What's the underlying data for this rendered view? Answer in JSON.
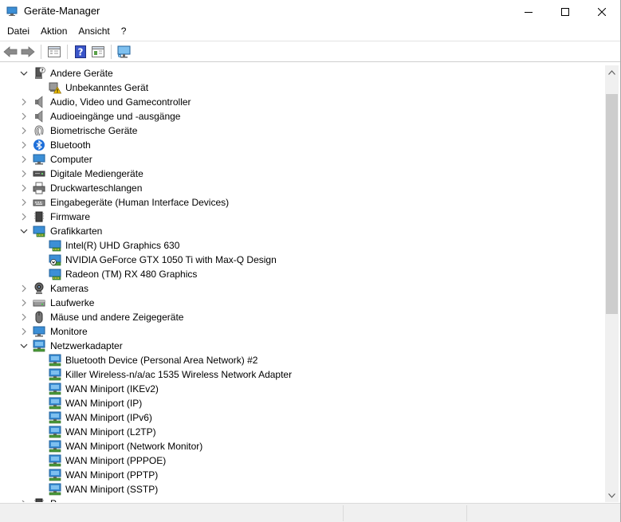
{
  "window": {
    "title": "Geräte-Manager"
  },
  "menu": [
    {
      "label": "Datei"
    },
    {
      "label": "Aktion"
    },
    {
      "label": "Ansicht"
    },
    {
      "label": "?"
    }
  ],
  "toolbar": {
    "buttons": [
      "back-icon",
      "forward-icon",
      "properties-view-icon",
      "help-icon",
      "details-view-icon",
      "monitor-scan-icon"
    ]
  },
  "tree": {
    "items": [
      {
        "label": "Andere Geräte",
        "level": 0,
        "expanded": true,
        "icon": "unknown-device-category-icon"
      },
      {
        "label": "Unbekanntes Gerät",
        "level": 1,
        "icon": "warning-device-icon"
      },
      {
        "label": "Audio, Video und Gamecontroller",
        "level": 0,
        "expanded": false,
        "icon": "speaker-icon"
      },
      {
        "label": "Audioeingänge und -ausgänge",
        "level": 0,
        "expanded": false,
        "icon": "speaker-icon"
      },
      {
        "label": "Biometrische Geräte",
        "level": 0,
        "expanded": false,
        "icon": "fingerprint-icon"
      },
      {
        "label": "Bluetooth",
        "level": 0,
        "expanded": false,
        "icon": "bluetooth-icon"
      },
      {
        "label": "Computer",
        "level": 0,
        "expanded": false,
        "icon": "computer-icon"
      },
      {
        "label": "Digitale Mediengeräte",
        "level": 0,
        "expanded": false,
        "icon": "media-device-icon"
      },
      {
        "label": "Druckwarteschlangen",
        "level": 0,
        "expanded": false,
        "icon": "printer-icon"
      },
      {
        "label": "Eingabegeräte (Human Interface Devices)",
        "level": 0,
        "expanded": false,
        "icon": "hid-icon"
      },
      {
        "label": "Firmware",
        "level": 0,
        "expanded": false,
        "icon": "chip-icon"
      },
      {
        "label": "Grafikkarten",
        "level": 0,
        "expanded": true,
        "icon": "display-adapter-icon"
      },
      {
        "label": "Intel(R) UHD Graphics 630",
        "level": 1,
        "icon": "display-adapter-icon"
      },
      {
        "label": "NVIDIA GeForce GTX 1050 Ti with Max-Q Design",
        "level": 1,
        "icon": "disabled-display-adapter-icon"
      },
      {
        "label": "Radeon (TM) RX 480 Graphics",
        "level": 1,
        "icon": "display-adapter-icon"
      },
      {
        "label": "Kameras",
        "level": 0,
        "expanded": false,
        "icon": "camera-icon"
      },
      {
        "label": "Laufwerke",
        "level": 0,
        "expanded": false,
        "icon": "drive-icon"
      },
      {
        "label": "Mäuse und andere Zeigegeräte",
        "level": 0,
        "expanded": false,
        "icon": "mouse-icon"
      },
      {
        "label": "Monitore",
        "level": 0,
        "expanded": false,
        "icon": "monitor-icon"
      },
      {
        "label": "Netzwerkadapter",
        "level": 0,
        "expanded": true,
        "icon": "network-adapter-icon"
      },
      {
        "label": "Bluetooth Device (Personal Area Network) #2",
        "level": 1,
        "icon": "network-adapter-icon"
      },
      {
        "label": "Killer Wireless-n/a/ac 1535 Wireless Network Adapter",
        "level": 1,
        "icon": "network-adapter-icon"
      },
      {
        "label": "WAN Miniport (IKEv2)",
        "level": 1,
        "icon": "network-adapter-icon"
      },
      {
        "label": "WAN Miniport (IP)",
        "level": 1,
        "icon": "network-adapter-icon"
      },
      {
        "label": "WAN Miniport (IPv6)",
        "level": 1,
        "icon": "network-adapter-icon"
      },
      {
        "label": "WAN Miniport (L2TP)",
        "level": 1,
        "icon": "network-adapter-icon"
      },
      {
        "label": "WAN Miniport (Network Monitor)",
        "level": 1,
        "icon": "network-adapter-icon"
      },
      {
        "label": "WAN Miniport (PPPOE)",
        "level": 1,
        "icon": "network-adapter-icon"
      },
      {
        "label": "WAN Miniport (PPTP)",
        "level": 1,
        "icon": "network-adapter-icon"
      },
      {
        "label": "WAN Miniport (SSTP)",
        "level": 1,
        "icon": "network-adapter-icon"
      },
      {
        "label": "P",
        "level": 0,
        "expanded": false,
        "icon": "chip-icon"
      }
    ]
  },
  "colors": {
    "accent_blue": "#3c8fd6",
    "scroll_thumb": "#cdcdcd",
    "warning_yellow": "#f2c200"
  }
}
